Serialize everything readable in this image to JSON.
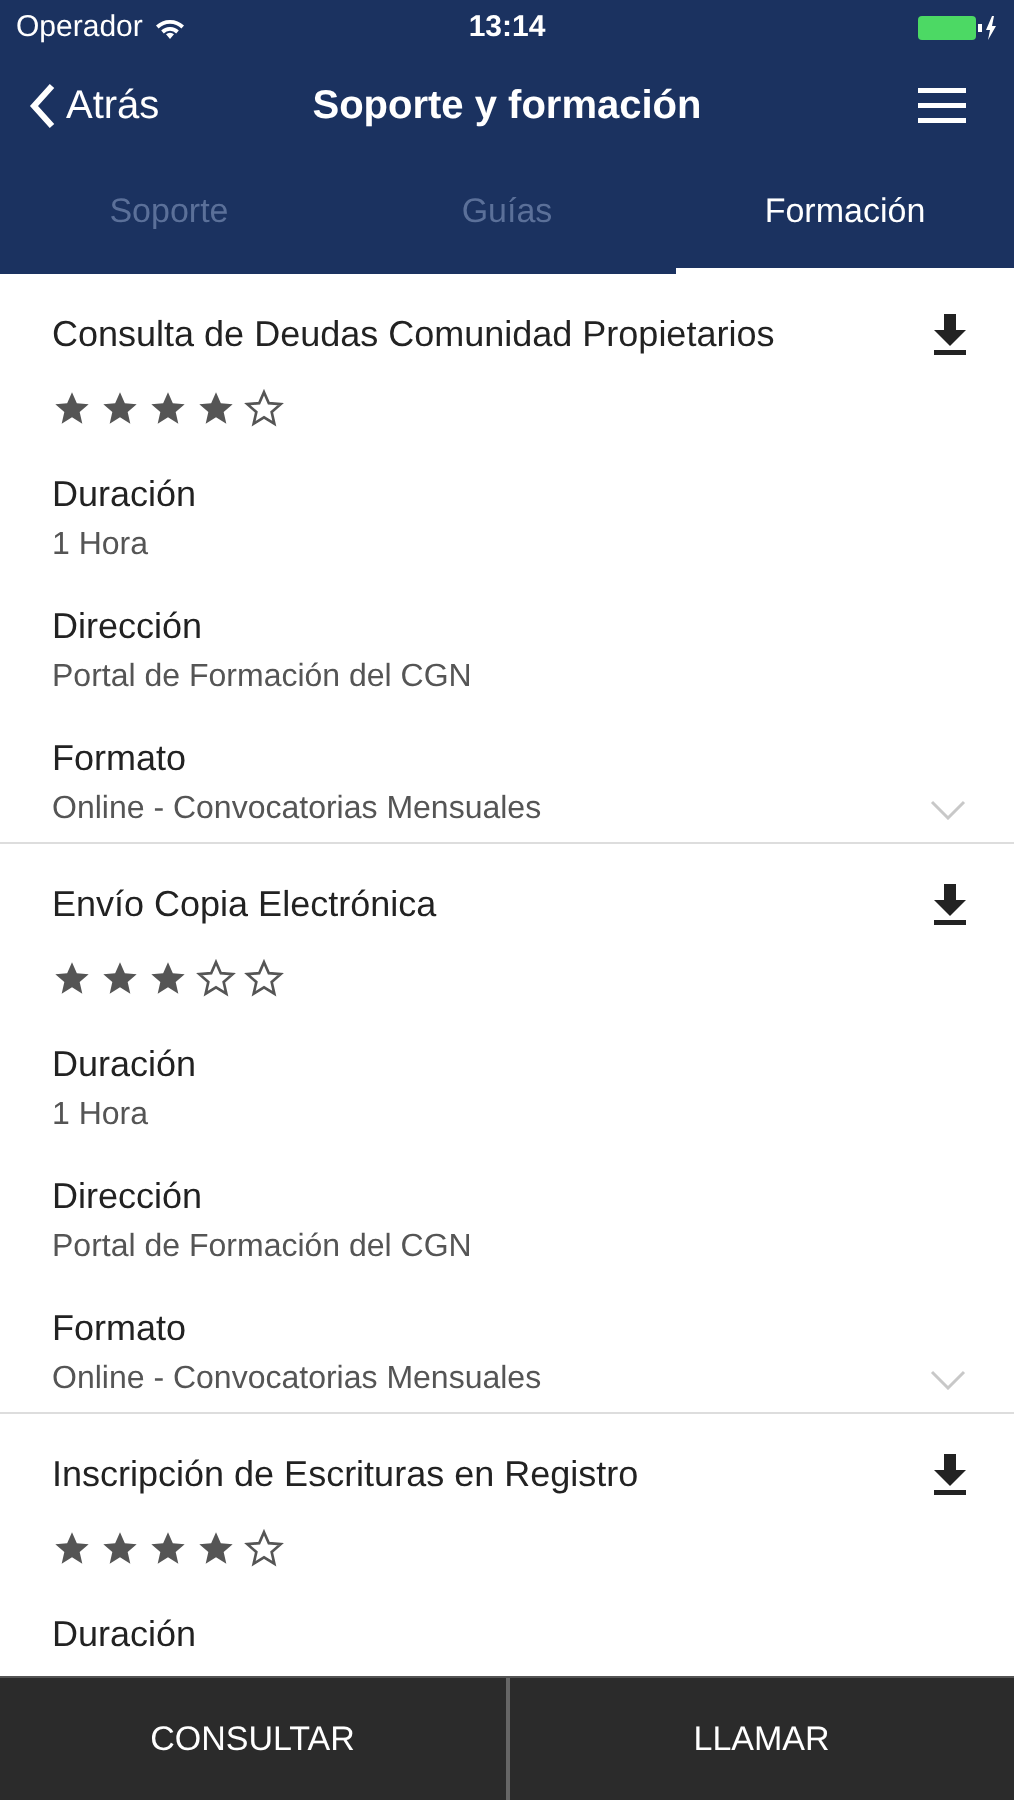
{
  "status_bar": {
    "carrier": "Operador",
    "time": "13:14"
  },
  "nav": {
    "back": "Atrás",
    "title": "Soporte y formación"
  },
  "tabs": [
    {
      "label": "Soporte",
      "selected": false
    },
    {
      "label": "Guías",
      "selected": false
    },
    {
      "label": "Formación",
      "selected": true
    }
  ],
  "courses": [
    {
      "title": "Consulta de Deudas Comunidad Propietarios",
      "stars": 4,
      "fields": [
        {
          "label": "Duración",
          "value": "1 Hora"
        },
        {
          "label": "Dirección",
          "value": "Portal de Formación del CGN"
        },
        {
          "label": "Formato",
          "value": "Online - Convocatorias Mensuales"
        }
      ],
      "expanded": false
    },
    {
      "title": "Envío Copia Electrónica",
      "stars": 3,
      "fields": [
        {
          "label": "Duración",
          "value": "1 Hora"
        },
        {
          "label": "Dirección",
          "value": "Portal de Formación del CGN"
        },
        {
          "label": "Formato",
          "value": "Online - Convocatorias Mensuales"
        }
      ],
      "expanded": false
    },
    {
      "title": "Inscripción de Escrituras en Registro",
      "stars": 4,
      "fields": [
        {
          "label": "Duración"
        }
      ]
    }
  ],
  "bottom_buttons": [
    "CONSULTAR",
    "LLAMAR"
  ]
}
